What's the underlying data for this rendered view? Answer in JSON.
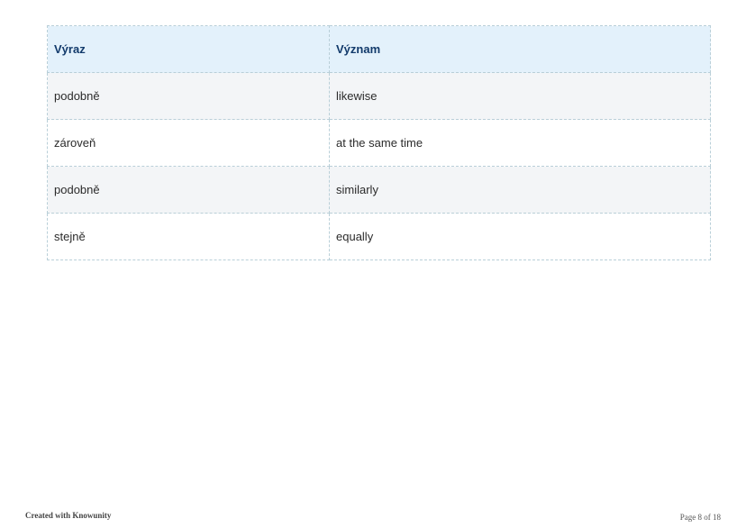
{
  "table": {
    "headers": [
      "Výraz",
      "Význam"
    ],
    "rows": [
      [
        "podobně",
        "likewise"
      ],
      [
        "zároveň",
        "at the same time"
      ],
      [
        "podobně",
        "similarly"
      ],
      [
        "stejně",
        "equally"
      ]
    ]
  },
  "footer": {
    "left": "Created with Knowunity",
    "right": "Page 8 of 18"
  },
  "colors": {
    "header_bg": "#e3f1fb",
    "header_text": "#123a6b",
    "row_alt_bg": "#f3f5f7",
    "border": "#b9cfd8"
  }
}
